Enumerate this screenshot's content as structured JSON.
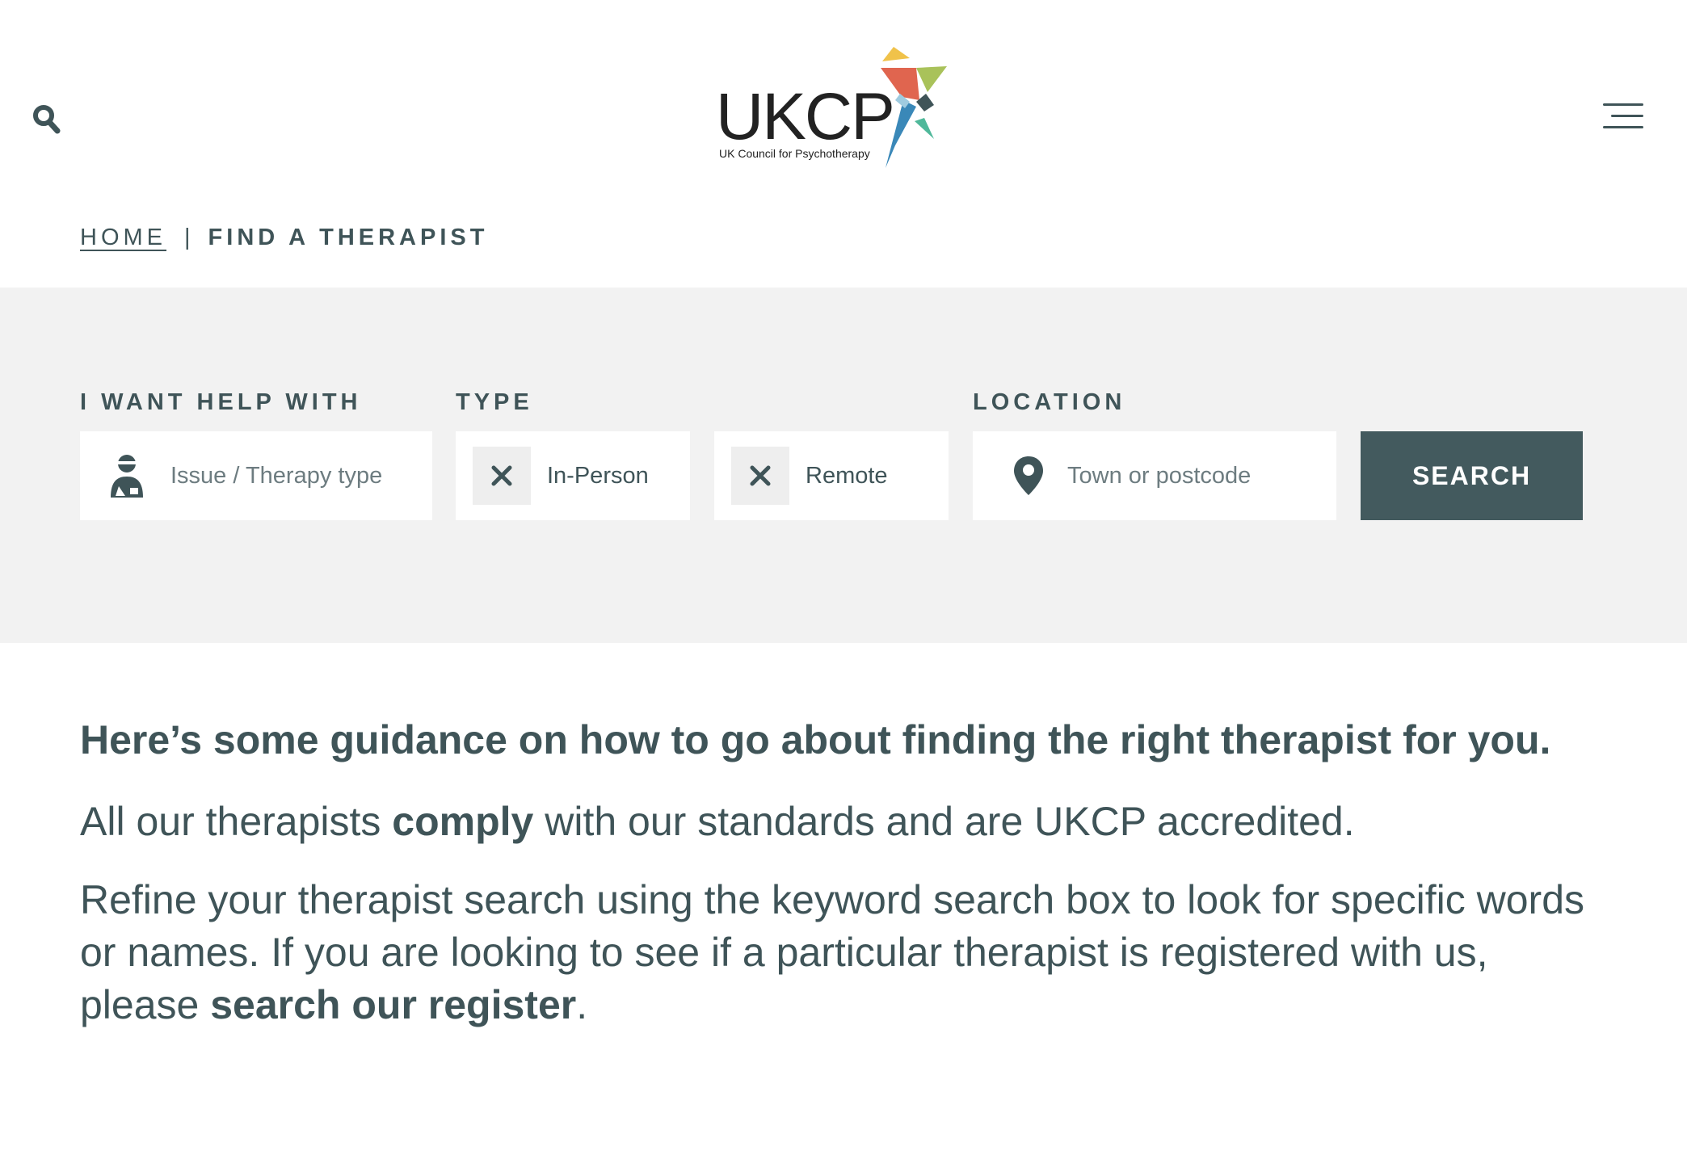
{
  "header": {
    "logo_text": "UKCP",
    "logo_subtitle": "UK Council for Psychotherapy",
    "search_icon": "search-icon",
    "menu_icon": "hamburger-menu-icon"
  },
  "breadcrumb": {
    "home": "HOME",
    "separator": "|",
    "current": "FIND A THERAPIST"
  },
  "search": {
    "help_label": "I WANT HELP WITH",
    "help_placeholder": "Issue / Therapy type",
    "help_icon": "person-support-icon",
    "type_label": "TYPE",
    "type_options": [
      "In-Person",
      "Remote"
    ],
    "remove_icon": "close-icon",
    "location_label": "LOCATION",
    "location_placeholder": "Town or postcode",
    "location_icon": "map-pin-icon",
    "button_label": "SEARCH"
  },
  "content": {
    "heading": "Here’s some guidance on how to go about finding the right therapist for you.",
    "para1_start": "All our therapists ",
    "para1_bold": "comply",
    "para1_end": " with our standards and are UKCP accredited.",
    "para2_start": "Refine your therapist search using the keyword search box to look for specific words or names. If you are looking to see if a particular therapist is registered with us, please ",
    "para2_link": "search our register",
    "para2_end": "."
  },
  "colors": {
    "text": "#3f5458",
    "panel": "#f2f2f2",
    "button": "#435a5e"
  }
}
